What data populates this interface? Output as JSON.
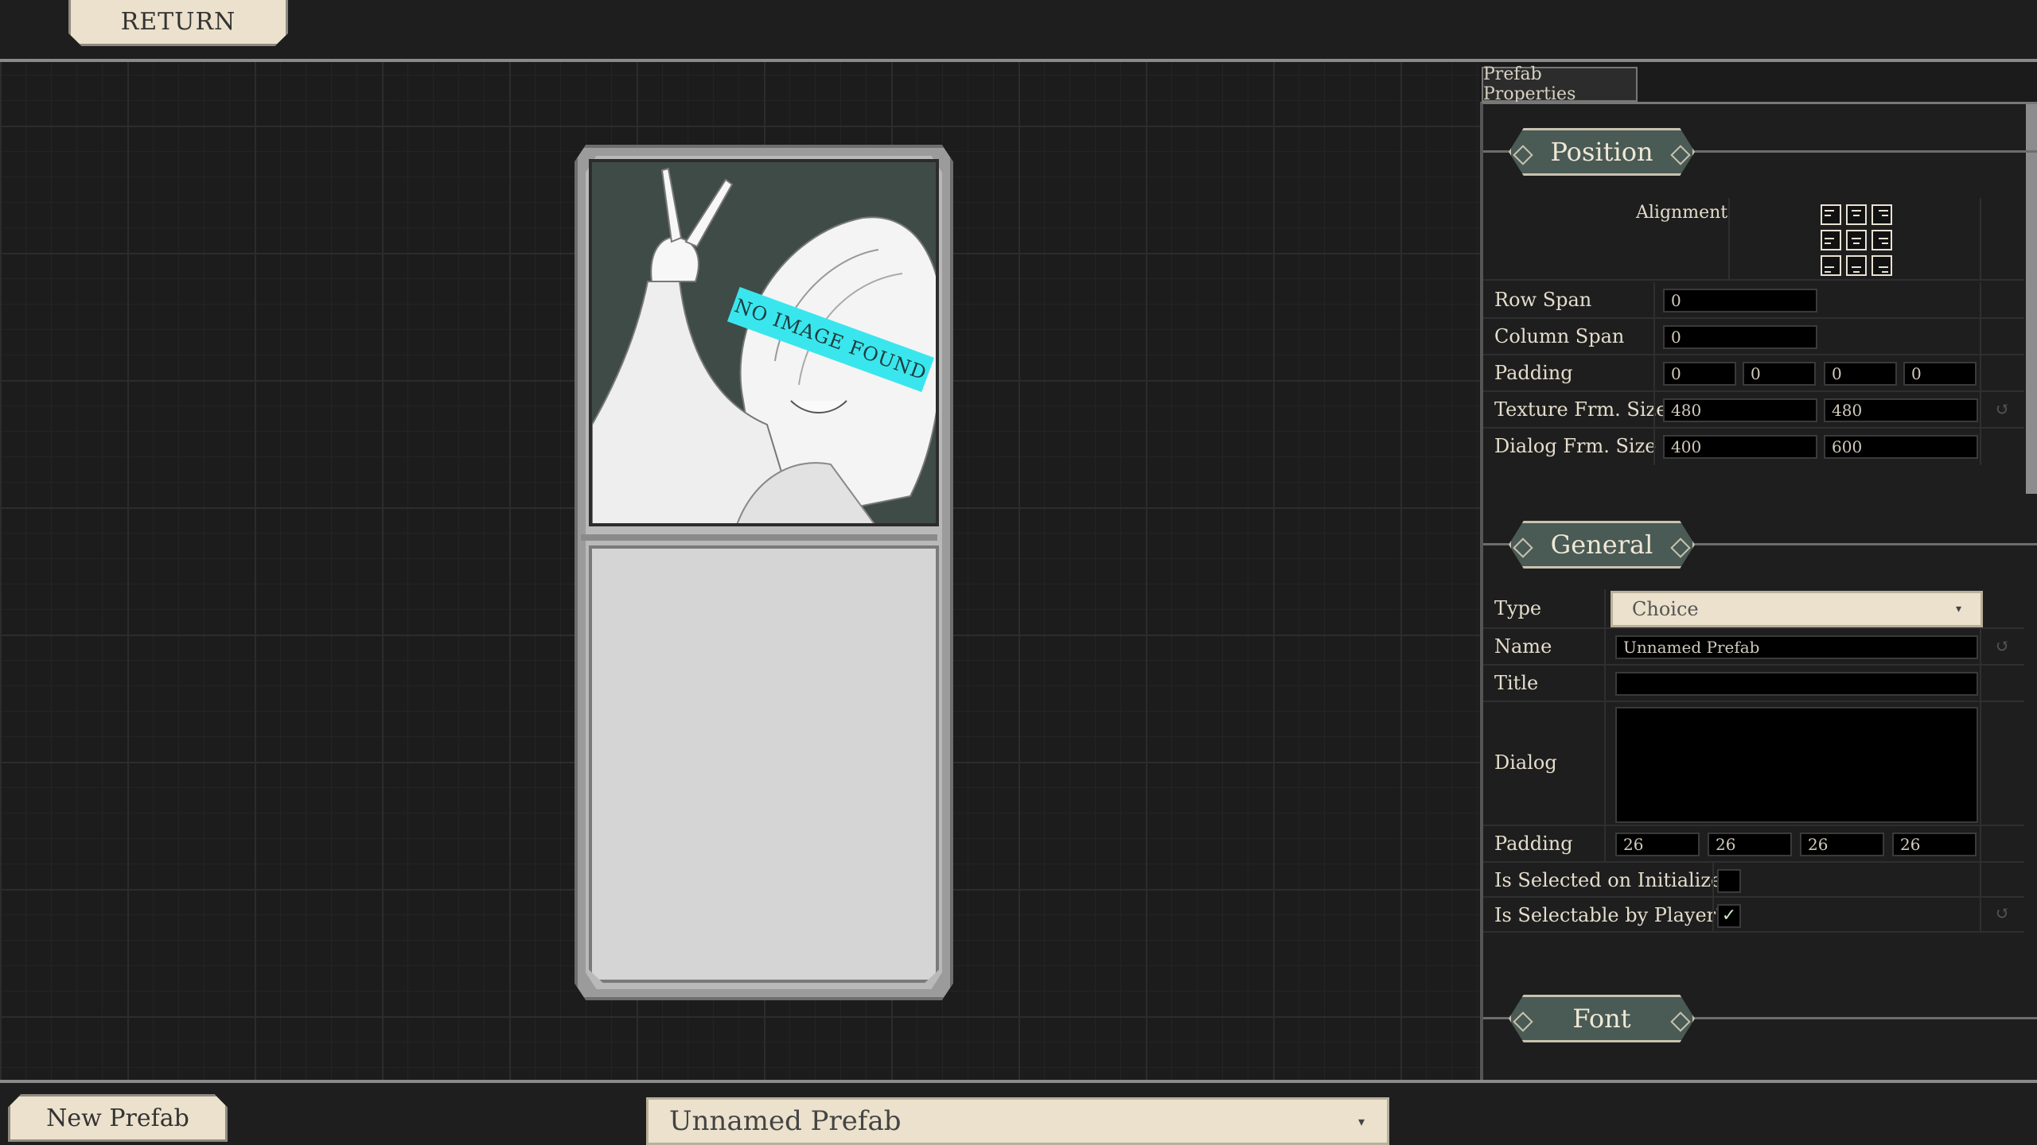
{
  "topbar": {
    "return_label": "RETURN"
  },
  "card": {
    "placeholder_tag": "NO IMAGE FOUND"
  },
  "panel": {
    "tab_label": "Prefab Properties",
    "position": {
      "title": "Position",
      "alignment_label": "Alignment",
      "row_span_label": "Row Span",
      "row_span_value": "0",
      "column_span_label": "Column Span",
      "column_span_value": "0",
      "padding_label": "Padding",
      "padding_values": [
        "0",
        "0",
        "0",
        "0"
      ],
      "texture_size_label": "Texture Frm. Size",
      "texture_size_values": [
        "480",
        "480"
      ],
      "dialog_size_label": "Dialog Frm. Size",
      "dialog_size_values": [
        "400",
        "600"
      ]
    },
    "general": {
      "title": "General",
      "type_label": "Type",
      "type_value": "Choice",
      "name_label": "Name",
      "name_value": "Unnamed Prefab",
      "title_label": "Title",
      "title_value": "",
      "dialog_label": "Dialog",
      "dialog_value": "",
      "padding_label": "Padding",
      "padding_values": [
        "26",
        "26",
        "26",
        "26"
      ],
      "selected_on_init_label": "Is Selected on Initialize?",
      "selected_on_init": false,
      "selectable_label": "Is Selectable by Player?",
      "selectable": true,
      "checkmark": "✓"
    },
    "font": {
      "title": "Font"
    }
  },
  "bottombar": {
    "new_prefab_label": "New Prefab",
    "prefab_select_value": "Unnamed Prefab"
  },
  "icons": {
    "caret": "caret-down-icon",
    "reset": "undo-icon"
  },
  "colors": {
    "accent_badge": "#4a5a55",
    "cream": "#ebe1cc",
    "placeholder_tag": "#39e6ee"
  }
}
